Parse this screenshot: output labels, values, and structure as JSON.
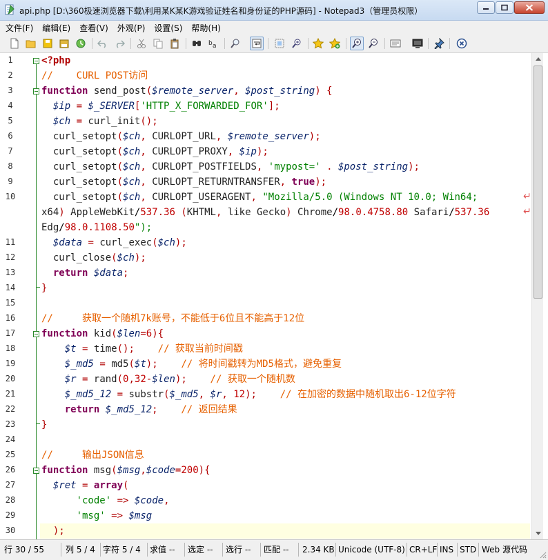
{
  "window": {
    "title": "api.php [D:\\360极速浏览器下载\\利用某K某K游戏验证姓名和身份证的PHP源码] - Notepad3（管理员权限）",
    "icon": "notepad3-icon"
  },
  "menu": [
    {
      "label": "文件(F)"
    },
    {
      "label": "编辑(E)"
    },
    {
      "label": "查看(V)"
    },
    {
      "label": "外观(P)"
    },
    {
      "label": "设置(S)"
    },
    {
      "label": "帮助(H)"
    }
  ],
  "toolbar": [
    {
      "name": "new-file-icon"
    },
    {
      "name": "open-file-icon"
    },
    {
      "name": "save-file-icon"
    },
    {
      "name": "save-all-icon"
    },
    {
      "name": "browse-icon"
    },
    {
      "name": "undo-icon"
    },
    {
      "name": "redo-icon"
    },
    {
      "name": "cut-icon"
    },
    {
      "name": "copy-icon"
    },
    {
      "name": "paste-icon"
    },
    {
      "name": "find-icon"
    },
    {
      "name": "replace-icon"
    },
    {
      "name": "find-file-icon"
    },
    {
      "name": "word-wrap-icon"
    },
    {
      "name": "select-block-icon"
    },
    {
      "name": "zoom-find-icon"
    },
    {
      "name": "favorite-icon"
    },
    {
      "name": "add-favorite-icon"
    },
    {
      "name": "zoom-in-icon"
    },
    {
      "name": "zoom-out-icon"
    },
    {
      "name": "schemes-icon"
    },
    {
      "name": "monitor-icon"
    },
    {
      "name": "pin-icon"
    },
    {
      "name": "exit-icon"
    }
  ],
  "editor": {
    "current_line": 30,
    "lines": [
      {
        "n": "1",
        "code": "<?php"
      },
      {
        "n": "2",
        "code": "//    CURL POST访问"
      },
      {
        "n": "3",
        "code": "function send_post($remote_server, $post_string) {"
      },
      {
        "n": "4",
        "code": "  $ip = $_SERVER['HTTP_X_FORWARDED_FOR'];"
      },
      {
        "n": "5",
        "code": "  $ch = curl_init();"
      },
      {
        "n": "6",
        "code": "  curl_setopt($ch, CURLOPT_URL, $remote_server);"
      },
      {
        "n": "7",
        "code": "  curl_setopt($ch, CURLOPT_PROXY, $ip);"
      },
      {
        "n": "8",
        "code": "  curl_setopt($ch, CURLOPT_POSTFIELDS, 'mypost=' . $post_string);"
      },
      {
        "n": "9",
        "code": "  curl_setopt($ch, CURLOPT_RETURNTRANSFER, true);"
      },
      {
        "n": "10",
        "code": "  curl_setopt($ch, CURLOPT_USERAGENT, \"Mozilla/5.0 (Windows NT 10.0; Win64;"
      },
      {
        "n": "",
        "code": "x64) AppleWebKit/537.36 (KHTML, like Gecko) Chrome/98.0.4758.80 Safari/537.36"
      },
      {
        "n": "",
        "code": "Edg/98.0.1108.50\");"
      },
      {
        "n": "11",
        "code": "  $data = curl_exec($ch);"
      },
      {
        "n": "12",
        "code": "  curl_close($ch);"
      },
      {
        "n": "13",
        "code": "  return $data;"
      },
      {
        "n": "14",
        "code": "}"
      },
      {
        "n": "15",
        "code": ""
      },
      {
        "n": "16",
        "code": "//     获取一个随机7k账号，不能低于6位且不能高于12位"
      },
      {
        "n": "17",
        "code": "function kid($len=6){"
      },
      {
        "n": "18",
        "code": "    $t = time();    // 获取当前时间戳"
      },
      {
        "n": "19",
        "code": "    $_md5 = md5($t);    // 将时间戳转为MD5格式，避免重复"
      },
      {
        "n": "20",
        "code": "    $r = rand(0,32-$len);    // 获取一个随机数"
      },
      {
        "n": "21",
        "code": "    $_md5_12 = substr($_md5, $r, 12);    // 在加密的数据中随机取出6-12位字符"
      },
      {
        "n": "22",
        "code": "    return $_md5_12;    // 返回结果"
      },
      {
        "n": "23",
        "code": "}"
      },
      {
        "n": "24",
        "code": ""
      },
      {
        "n": "25",
        "code": "//     输出JSON信息"
      },
      {
        "n": "26",
        "code": "function msg($msg,$code=200){"
      },
      {
        "n": "27",
        "code": "  $ret = array("
      },
      {
        "n": "28",
        "code": "      'code' => $code,"
      },
      {
        "n": "29",
        "code": "      'msg' => $msg"
      },
      {
        "n": "30",
        "code": "  );"
      }
    ]
  },
  "status": {
    "line": "行 30 / 55",
    "col": "列 5 / 4",
    "char": "字符 5 / 4",
    "value": "求值 --",
    "sel": "选定 --",
    "sellines": "选行 --",
    "match": "匹配 --",
    "size": "2.34 KB",
    "encoding": "Unicode (UTF-8)",
    "eol": "CR+LF",
    "ins": "INS",
    "std": "STD",
    "lexer": "Web 源代码"
  }
}
